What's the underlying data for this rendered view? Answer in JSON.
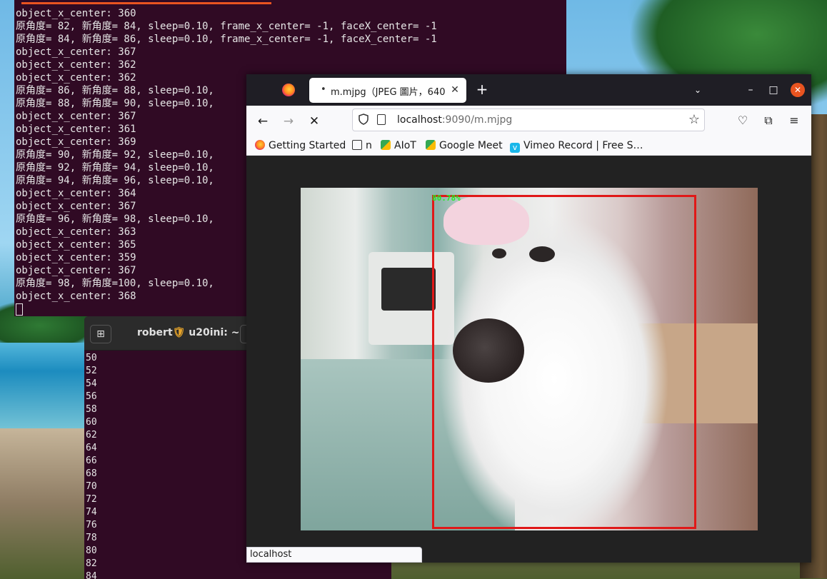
{
  "colors": {
    "terminal_bg": "#300a24",
    "accent": "#e95420",
    "bbox": "#e01818",
    "score": "#22ee22"
  },
  "terminal_top": {
    "lines": [
      "object_x_center: 360",
      "原角度= 82, 新角度= 84, sleep=0.10, frame_x_center= -1, faceX_center= -1",
      "原角度= 84, 新角度= 86, sleep=0.10, frame_x_center= -1, faceX_center= -1",
      "object_x_center: 367",
      "object_x_center: 362",
      "object_x_center: 362",
      "原角度= 86, 新角度= 88, sleep=0.10,",
      "原角度= 88, 新角度= 90, sleep=0.10,",
      "object_x_center: 367",
      "object_x_center: 361",
      "object_x_center: 369",
      "原角度= 90, 新角度= 92, sleep=0.10,",
      "原角度= 92, 新角度= 94, sleep=0.10,",
      "原角度= 94, 新角度= 96, sleep=0.10,",
      "object_x_center: 364",
      "object_x_center: 367",
      "原角度= 96, 新角度= 98, sleep=0.10,",
      "object_x_center: 363",
      "object_x_center: 365",
      "object_x_center: 359",
      "object_x_center: 367",
      "原角度= 98, 新角度=100, sleep=0.10,",
      "object_x_center: 368"
    ]
  },
  "terminal_bottom": {
    "title_user": "robert",
    "title_host": "u20ini: ~",
    "lines": [
      "50",
      "52",
      "54",
      "56",
      "58",
      "60",
      "62",
      "64",
      "66",
      "68",
      "70",
      "72",
      "74",
      "76",
      "78",
      "80",
      "82",
      "84"
    ]
  },
  "browser": {
    "tab_dot": "•",
    "tab_title": "m.mjpg（JPEG 圖片，640",
    "tab_close": "✕",
    "new_tab": "+",
    "url_host": "localhost",
    "url_rest": ":9090/m.mjpg",
    "bookmarks": [
      {
        "label": "Getting Started",
        "icon": "firefox-icon"
      },
      {
        "label": "n",
        "icon": "folder-icon"
      },
      {
        "label": "AIoT",
        "icon": "meet-icon"
      },
      {
        "label": "Google Meet",
        "icon": "meet-icon"
      },
      {
        "label": "Vimeo Record | Free S…",
        "icon": "vimeo-icon"
      }
    ],
    "detection_score": "80.78%",
    "status_text": "localhost"
  }
}
